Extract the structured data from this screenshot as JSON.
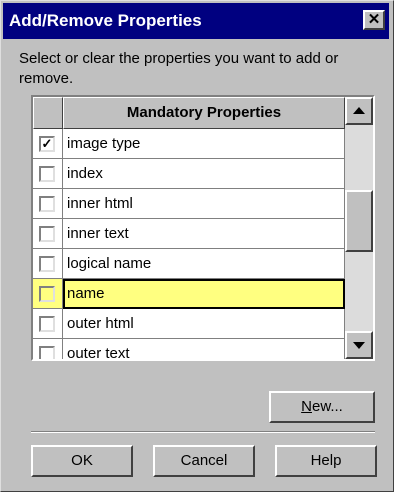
{
  "window": {
    "title": "Add/Remove Properties",
    "close_glyph": "✕"
  },
  "instructions": "Select or clear the properties you want to add or remove.",
  "grid": {
    "header": "Mandatory Properties",
    "rows": [
      {
        "label": "image type",
        "checked": true,
        "selected": false
      },
      {
        "label": "index",
        "checked": false,
        "selected": false
      },
      {
        "label": "inner html",
        "checked": false,
        "selected": false
      },
      {
        "label": "inner text",
        "checked": false,
        "selected": false
      },
      {
        "label": "logical name",
        "checked": false,
        "selected": false
      },
      {
        "label": "name",
        "checked": false,
        "selected": true
      },
      {
        "label": "outer html",
        "checked": false,
        "selected": false
      },
      {
        "label": "outer text",
        "checked": false,
        "selected": false
      }
    ],
    "scroll_position": 0.45
  },
  "buttons": {
    "new_mnemonic": "N",
    "new_rest": "ew...",
    "ok": "OK",
    "cancel": "Cancel",
    "help": "Help"
  },
  "colors": {
    "titlebar": "#000080",
    "dialog": "#c0c0c0",
    "selected_row": "#ffff80"
  },
  "icons": {
    "close": "close-icon",
    "scroll_up": "arrow-up-icon",
    "scroll_down": "arrow-down-icon",
    "checkmark": "checkmark-icon"
  }
}
